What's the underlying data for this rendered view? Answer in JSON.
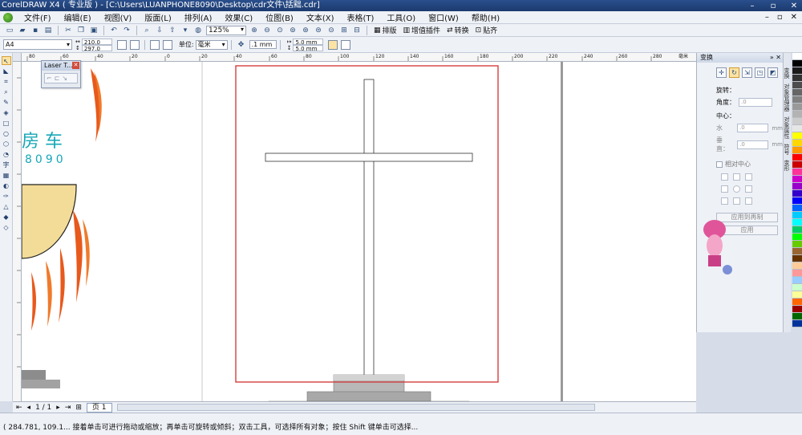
{
  "window": {
    "title": "CorelDRAW X4 ( 专业版 ) - [C:\\Users\\LUANPHONE8090\\Desktop\\cdr文件\\括黜.cdr]"
  },
  "menu": [
    "文件(F)",
    "编辑(E)",
    "视图(V)",
    "版面(L)",
    "排列(A)",
    "效果(C)",
    "位图(B)",
    "文本(X)",
    "表格(T)",
    "工具(O)",
    "窗口(W)",
    "帮助(H)"
  ],
  "toolbar": {
    "zoom": "125%",
    "layout_label": "排版",
    "plugin_label": "增值插件",
    "convert_label": "转换",
    "paste_label": "贴齐"
  },
  "propbar": {
    "page_size": "A4",
    "width": "210.0 mm",
    "height": "297.0 mm",
    "unit_label": "单位:",
    "unit_value": "毫米",
    "nudge": ".1 mm",
    "dup_x": "5.0 mm",
    "dup_y": "5.0 mm"
  },
  "ruler": {
    "h_ticks": [
      "80",
      "60",
      "40",
      "20",
      "0",
      "20",
      "40",
      "60",
      "80",
      "100",
      "120",
      "140",
      "160",
      "180",
      "200",
      "220",
      "240",
      "260",
      "280"
    ],
    "unit": "毫米"
  },
  "laser_docker": {
    "title": "Laser T..."
  },
  "canvas": {
    "partial_text_1": "房 车",
    "partial_text_2": "8090"
  },
  "pagebar": {
    "page_count": "1 / 1",
    "page_tab": "页 1"
  },
  "status": {
    "text": "( 284.781, 109.1...  接着单击可进行拖动或缩放；再单击可旋转或倾斜；双击工具，可选择所有对象；按住 Shift 键单击可选择..."
  },
  "docker": {
    "title": "变换",
    "rotate_label": "旋转：",
    "angle_label": "角度：",
    "angle_value": ".0",
    "center_label": "中心：",
    "h_label": "水",
    "h_value": ".0",
    "v_label": "垂直：",
    "v_value": ".0",
    "unit": "mm",
    "relative_center": "相对中心",
    "apply_copy": "应用到再制",
    "apply": "应用"
  },
  "docker_tabs": [
    "变换",
    "对象管理器",
    "对象属性",
    "符号",
    "变形",
    "提示",
    "字符格式化"
  ],
  "palette": [
    "#ffffff",
    "#000000",
    "#1a1a1a",
    "#333333",
    "#4d4d4d",
    "#666666",
    "#808080",
    "#999999",
    "#b3b3b3",
    "#cccccc",
    "#e6e6e6",
    "#ffff00",
    "#ffd700",
    "#ff9900",
    "#ff0000",
    "#cc0000",
    "#ff3399",
    "#cc00cc",
    "#9900cc",
    "#3300cc",
    "#0000ff",
    "#0066ff",
    "#00ccff",
    "#00ffff",
    "#00cc66",
    "#00ff00",
    "#66cc00",
    "#996633",
    "#663300",
    "#ffcc99",
    "#ff9999",
    "#99ccff",
    "#ccffcc",
    "#ffff99",
    "#ff6600",
    "#990000",
    "#006600",
    "#003399"
  ]
}
